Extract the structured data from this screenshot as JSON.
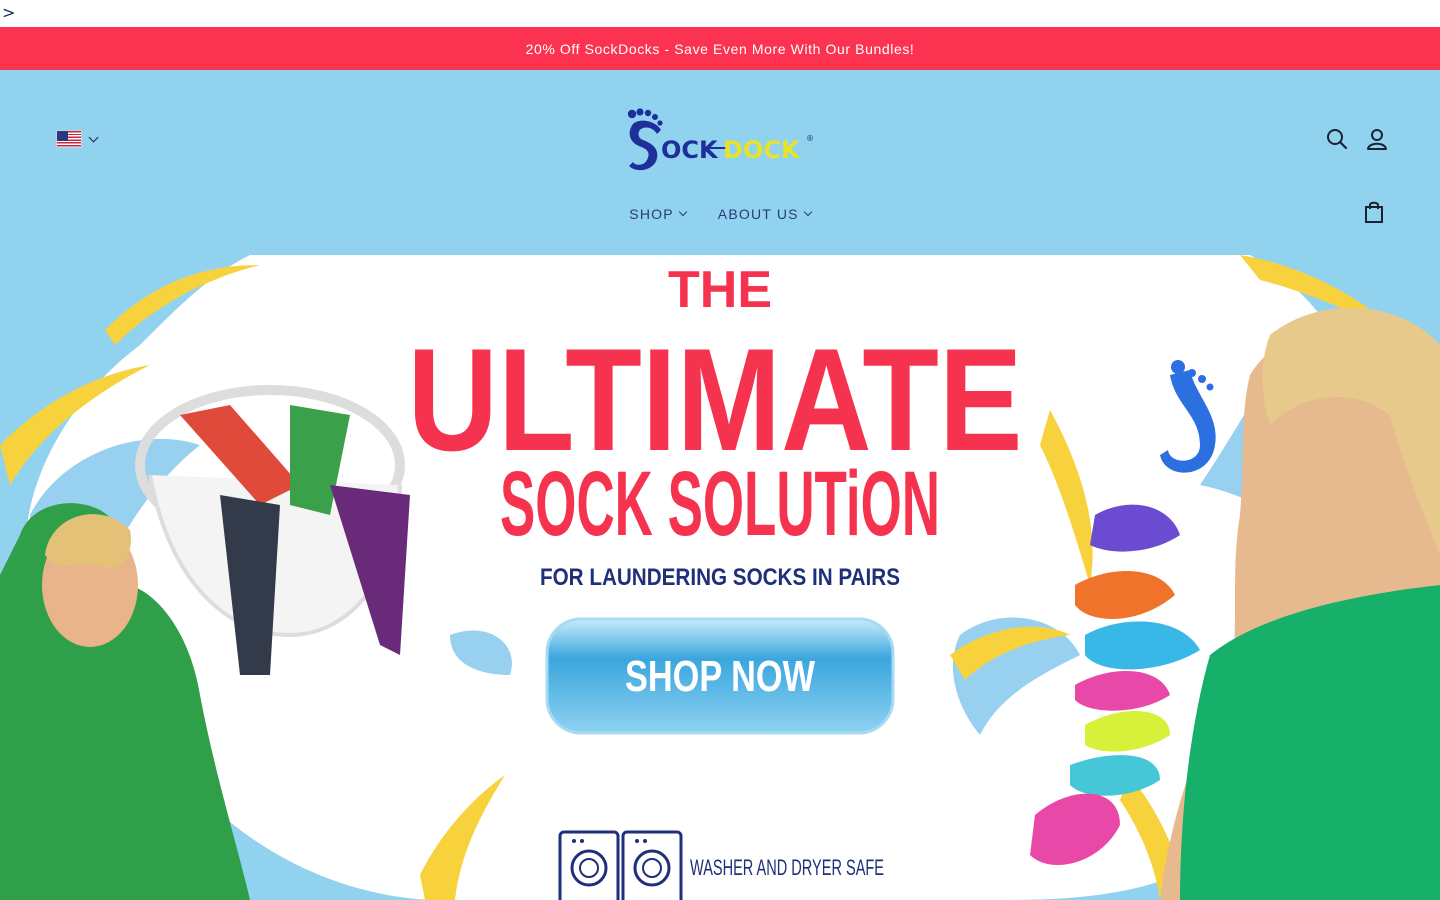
{
  "stray_char": ">",
  "announcement": {
    "text": "20% Off SockDocks - Save Even More With Our Bundles!"
  },
  "header": {
    "locale": {
      "icon": "us-flag-icon"
    },
    "logo": {
      "word1": "OCK",
      "word2": "DOCK",
      "registered": "®",
      "initial": "S"
    },
    "icons": [
      "search-icon",
      "account-icon",
      "cart-icon"
    ]
  },
  "nav": {
    "items": [
      {
        "label": "SHOP"
      },
      {
        "label": "ABOUT US"
      }
    ]
  },
  "hero": {
    "the": "THE",
    "headline": "ULTIMATE",
    "subheadline": "SOCK SOLUTiON",
    "tagline": "FOR LAUNDERING SOCKS IN PAIRS",
    "cta": "SHOP NOW",
    "badge": "WASHER AND DRYER SAFE"
  },
  "colors": {
    "announcement_bg": "#fc3350",
    "header_bg": "#91d3ef",
    "headline": "#f5334f",
    "navy": "#1f2f7a",
    "accent_yellow": "#f7d23c",
    "button_blue": "#3aa6dd"
  }
}
